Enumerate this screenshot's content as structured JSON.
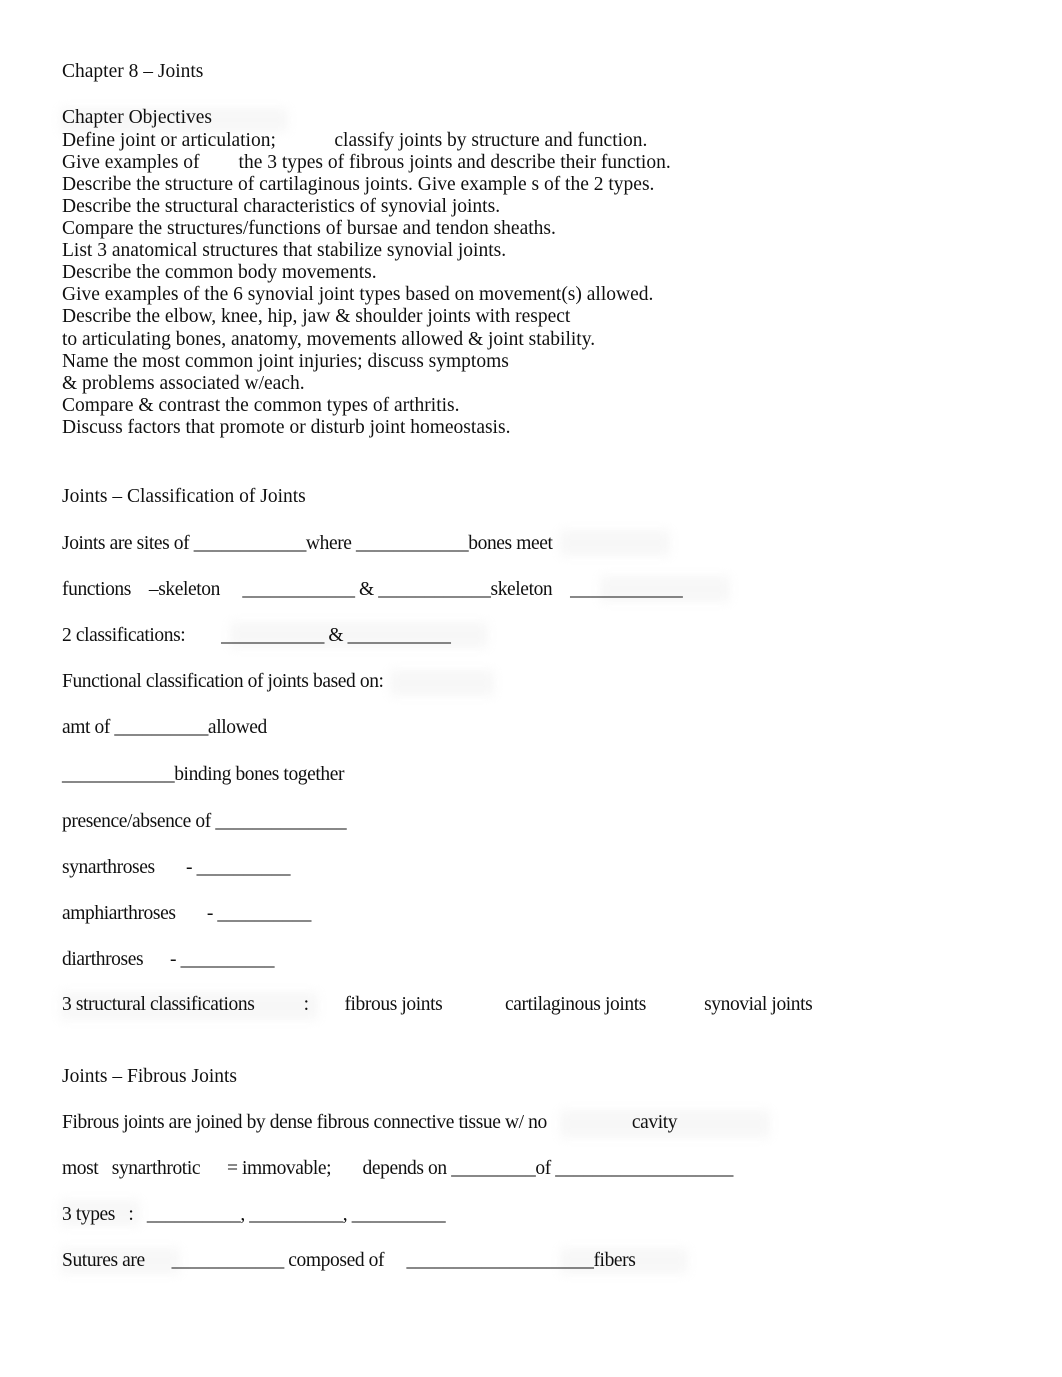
{
  "document": {
    "title": "Chapter 8 – Joints",
    "page_background": "#ffffff",
    "text_color": "#101010",
    "highlight_residue_color": "#f0f0f0"
  },
  "objectives": {
    "heading": "Chapter Objectives",
    "items": [
      "Define joint or articulation;            classify joints by structure and function.",
      "Give examples of        the 3 types of fibrous joints and describe their function.",
      "Describe the structure of cartilaginous joints. Give example s of the 2 types.",
      "Describe the structural characteristics of synovial joints.",
      "Compare the structures/functions of bursae and tendon sheaths.",
      "List 3 anatomical structures that stabilize synovial joints.",
      "Describe the common body movements.",
      "Give examples of the 6 synovial joint types based on movement(s) allowed.",
      "Describe the elbow, knee, hip, jaw & shoulder joints with respect",
      "to articulating bones, anatomy, movements allowed & joint stability.",
      "Name the most common joint injuries; discuss symptoms",
      "& problems associated w/each.",
      "Compare & contrast the common types of arthritis.",
      "Discuss factors that promote or disturb joint homeostasis."
    ]
  },
  "classification_section": {
    "heading": "Joints – Classification of Joints",
    "lines": [
      "Joints are sites of ____________where ____________bones meet",
      "functions    –skeleton     ____________ & ____________skeleton    ____________",
      "2 classifications:        ___________ & ___________",
      "Functional classification of joints based on:",
      "amt of __________allowed",
      "____________binding bones together",
      "presence/absence of ______________",
      "synarthroses       - __________",
      "amphiarthroses       - __________",
      "diarthroses      - __________",
      "3 structural classifications           :        fibrous joints              cartilaginous joints             synovial joints"
    ]
  },
  "fibrous_section": {
    "heading": "Joints – Fibrous Joints",
    "lines": [
      "Fibrous joints are joined by dense fibrous connective tissue w/ no                   cavity",
      "most   synarthrotic      = immovable;       depends on _________of ___________________",
      "3 types   :   __________, __________, __________",
      "Sutures are      ____________ composed of     ____________________fibers"
    ]
  }
}
